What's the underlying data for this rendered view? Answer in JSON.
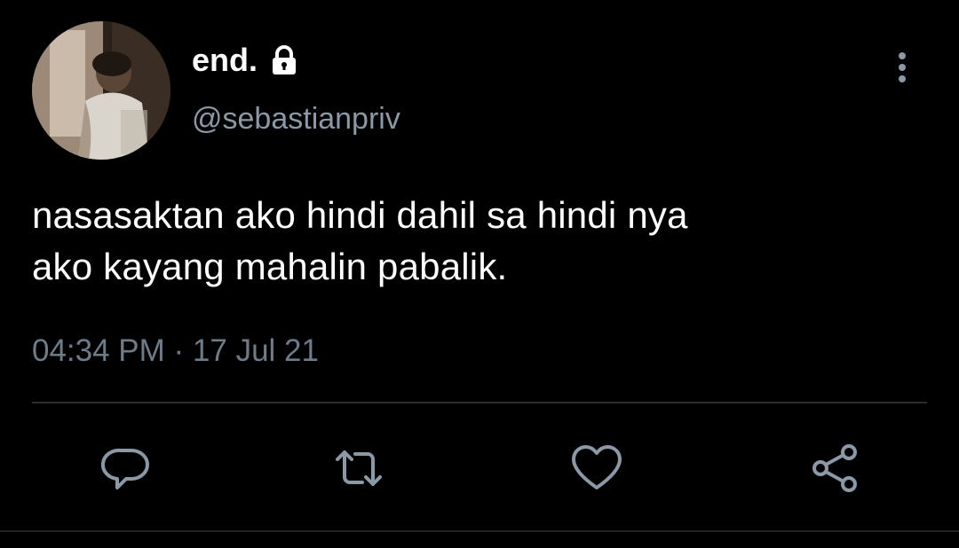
{
  "tweet": {
    "display_name": "end.",
    "handle": "@sebastianpriv",
    "text_line1": "nasasaktan ako hindi dahil sa hindi nya",
    "text_line2": "ako kayang mahalin pabalik.",
    "timestamp": "04:34 PM · 17 Jul 21",
    "account_locked": true
  },
  "icons": {
    "lock": "lock-icon",
    "more": "vertical-ellipsis-icon",
    "reply": "reply-icon",
    "retweet": "retweet-icon",
    "like": "heart-icon",
    "share": "share-icon"
  },
  "colors": {
    "background": "#000000",
    "primary_text": "#ffffff",
    "secondary_text": "#8b98a5",
    "icon": "#8b98a5",
    "divider": "#2a2e33"
  }
}
